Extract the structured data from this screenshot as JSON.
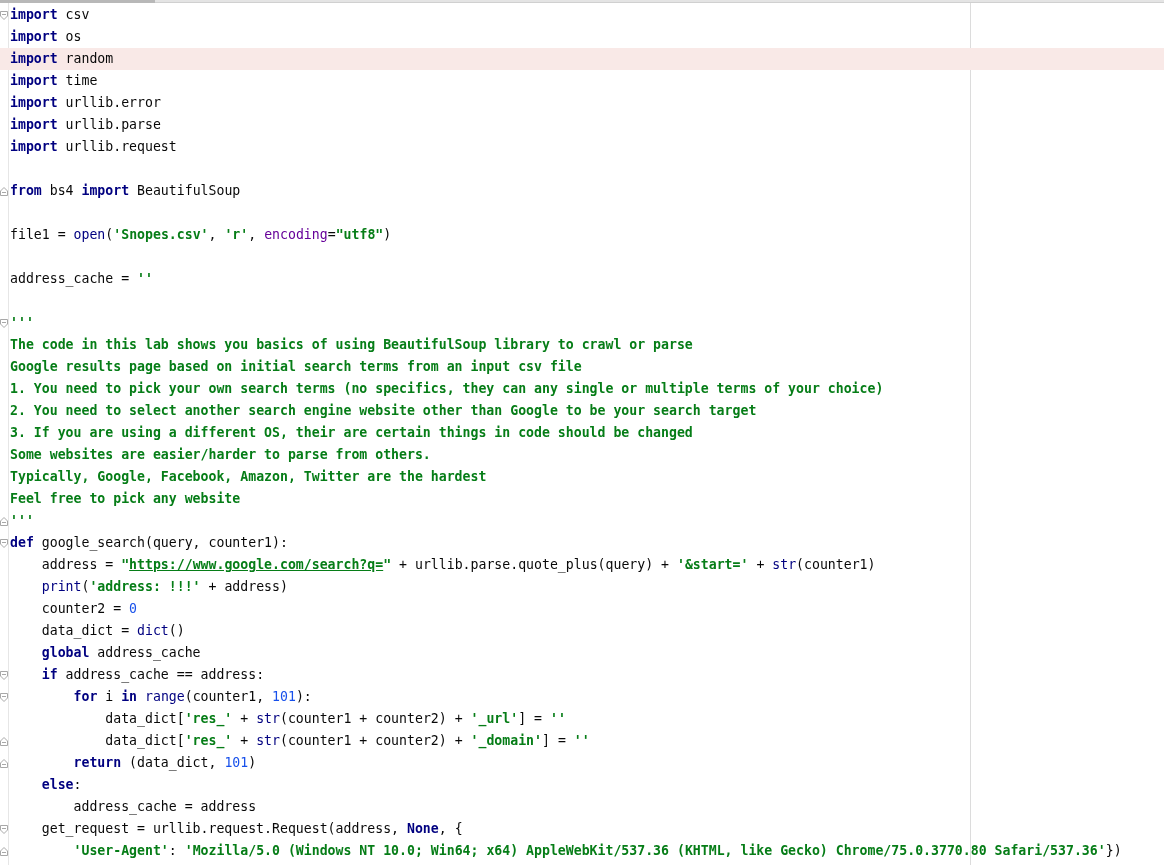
{
  "lines": [
    {
      "highlighted": false,
      "kind": "opener",
      "tokens": [
        {
          "kind": "keyword",
          "text": "import"
        },
        {
          "kind": "text",
          "text": " csv"
        }
      ]
    },
    {
      "highlighted": false,
      "kind": "plain",
      "tokens": [
        {
          "kind": "keyword",
          "text": "import"
        },
        {
          "kind": "text",
          "text": " os"
        }
      ]
    },
    {
      "highlighted": true,
      "kind": "plain",
      "tokens": [
        {
          "kind": "keyword",
          "text": "import"
        },
        {
          "kind": "text",
          "text": " random"
        }
      ]
    },
    {
      "highlighted": false,
      "kind": "plain",
      "tokens": [
        {
          "kind": "keyword",
          "text": "import"
        },
        {
          "kind": "text",
          "text": " time"
        }
      ]
    },
    {
      "highlighted": false,
      "kind": "plain",
      "tokens": [
        {
          "kind": "keyword",
          "text": "import"
        },
        {
          "kind": "text",
          "text": " urllib.error"
        }
      ]
    },
    {
      "highlighted": false,
      "kind": "plain",
      "tokens": [
        {
          "kind": "keyword",
          "text": "import"
        },
        {
          "kind": "text",
          "text": " urllib.parse"
        }
      ]
    },
    {
      "highlighted": false,
      "kind": "plain",
      "tokens": [
        {
          "kind": "keyword",
          "text": "import"
        },
        {
          "kind": "text",
          "text": " urllib.request"
        }
      ]
    },
    {
      "highlighted": false,
      "kind": "plain"
    },
    {
      "highlighted": false,
      "kind": "closer",
      "tokens": [
        {
          "kind": "keyword",
          "text": "from"
        },
        {
          "kind": "text",
          "text": " bs4 "
        },
        {
          "kind": "keyword",
          "text": "import"
        },
        {
          "kind": "text",
          "text": " BeautifulSoup"
        }
      ]
    },
    {
      "highlighted": false,
      "kind": "plain"
    },
    {
      "highlighted": false,
      "kind": "plain",
      "tokens": [
        {
          "kind": "text",
          "text": "file1 = "
        },
        {
          "kind": "builtin",
          "text": "open"
        },
        {
          "kind": "text",
          "text": "("
        },
        {
          "kind": "string",
          "text": "'Snopes.csv'"
        },
        {
          "kind": "text",
          "text": ", "
        },
        {
          "kind": "string",
          "text": "'r'"
        },
        {
          "kind": "text",
          "text": ", "
        },
        {
          "kind": "param",
          "text": "encoding"
        },
        {
          "kind": "text",
          "text": "="
        },
        {
          "kind": "string",
          "text": "\"utf8\""
        },
        {
          "kind": "text",
          "text": ")"
        }
      ]
    },
    {
      "highlighted": false,
      "kind": "plain"
    },
    {
      "highlighted": false,
      "kind": "plain",
      "tokens": [
        {
          "kind": "text",
          "text": "address_cache = "
        },
        {
          "kind": "string",
          "text": "''"
        }
      ]
    },
    {
      "highlighted": false,
      "kind": "plain"
    },
    {
      "highlighted": false,
      "kind": "opener",
      "tokens": [
        {
          "kind": "doc",
          "text": "'''"
        }
      ]
    },
    {
      "highlighted": false,
      "kind": "plain",
      "tokens": [
        {
          "kind": "doc",
          "text": "The code in this lab shows you basics of using BeautifulSoup library to crawl or parse"
        }
      ]
    },
    {
      "highlighted": false,
      "kind": "plain",
      "tokens": [
        {
          "kind": "doc",
          "text": "Google results page based on initial search terms from an input csv file"
        }
      ]
    },
    {
      "highlighted": false,
      "kind": "plain",
      "tokens": [
        {
          "kind": "doc",
          "text": "1. You need to pick your own search terms (no specifics, they can any single or multiple terms of your choice)"
        }
      ]
    },
    {
      "highlighted": false,
      "kind": "plain",
      "tokens": [
        {
          "kind": "doc",
          "text": "2. You need to select another search engine website other than Google to be your search target"
        }
      ]
    },
    {
      "highlighted": false,
      "kind": "plain",
      "tokens": [
        {
          "kind": "doc",
          "text": "3. If you are using a different OS, their are certain things in code should be changed"
        }
      ]
    },
    {
      "highlighted": false,
      "kind": "plain",
      "tokens": [
        {
          "kind": "doc",
          "text": "Some websites are easier/harder to parse from others."
        }
      ]
    },
    {
      "highlighted": false,
      "kind": "plain",
      "tokens": [
        {
          "kind": "doc",
          "text": "Typically, Google, Facebook, Amazon, Twitter are the hardest"
        }
      ]
    },
    {
      "highlighted": false,
      "kind": "plain",
      "tokens": [
        {
          "kind": "doc",
          "text": "Feel free to pick any website"
        }
      ]
    },
    {
      "highlighted": false,
      "kind": "closer",
      "tokens": [
        {
          "kind": "doc",
          "text": "'''"
        }
      ]
    },
    {
      "highlighted": false,
      "kind": "opener",
      "tokens": [
        {
          "kind": "keyword",
          "text": "def"
        },
        {
          "kind": "text",
          "text": " google_search(query, counter1):"
        }
      ],
      "children": [
        {
          "highlighted": false,
          "kind": "plain",
          "tokens": [
            {
              "kind": "text",
              "text": "address = "
            },
            {
              "kind": "string",
              "text": "\""
            },
            {
              "kind": "url",
              "text": "https://www.google.com/search?q="
            },
            {
              "kind": "string",
              "text": "\""
            },
            {
              "kind": "text",
              "text": " + urllib.parse.quote_plus(query) + "
            },
            {
              "kind": "string",
              "text": "'&start='"
            },
            {
              "kind": "text",
              "text": " + "
            },
            {
              "kind": "builtin",
              "text": "str"
            },
            {
              "kind": "text",
              "text": "(counter1)"
            }
          ]
        },
        {
          "highlighted": false,
          "kind": "plain",
          "tokens": [
            {
              "kind": "builtin",
              "text": "print"
            },
            {
              "kind": "text",
              "text": "("
            },
            {
              "kind": "string",
              "text": "'address: !!!'"
            },
            {
              "kind": "text",
              "text": " + address)"
            }
          ]
        },
        {
          "highlighted": false,
          "kind": "plain",
          "tokens": [
            {
              "kind": "text",
              "text": "counter2 = "
            },
            {
              "kind": "number",
              "text": "0"
            }
          ]
        },
        {
          "highlighted": false,
          "kind": "plain",
          "tokens": [
            {
              "kind": "text",
              "text": "data_dict = "
            },
            {
              "kind": "builtin",
              "text": "dict"
            },
            {
              "kind": "text",
              "text": "()"
            }
          ]
        },
        {
          "highlighted": false,
          "kind": "plain",
          "tokens": [
            {
              "kind": "keyword",
              "text": "global"
            },
            {
              "kind": "text",
              "text": " address_cache"
            }
          ]
        },
        {
          "highlighted": false,
          "kind": "opener",
          "tokens": [
            {
              "kind": "keyword",
              "text": "if"
            },
            {
              "kind": "text",
              "text": " address_cache == address:"
            }
          ],
          "children": [
            {
              "highlighted": false,
              "kind": "opener",
              "tokens": [
                {
                  "kind": "keyword",
                  "text": "for"
                },
                {
                  "kind": "text",
                  "text": " i "
                },
                {
                  "kind": "keyword",
                  "text": "in"
                },
                {
                  "kind": "builtin",
                  "text": " range"
                },
                {
                  "kind": "text",
                  "text": "(counter1, "
                },
                {
                  "kind": "number",
                  "text": "101"
                },
                {
                  "kind": "text",
                  "text": "):"
                }
              ],
              "children": [
                {
                  "highlighted": false,
                  "kind": "plain",
                  "tokens": [
                    {
                      "kind": "text",
                      "text": "data_dict["
                    },
                    {
                      "kind": "string",
                      "text": "'res_'"
                    },
                    {
                      "kind": "text",
                      "text": " + "
                    },
                    {
                      "kind": "builtin",
                      "text": "str"
                    },
                    {
                      "kind": "text",
                      "text": "(counter1 + counter2) + "
                    },
                    {
                      "kind": "string",
                      "text": "'_url'"
                    },
                    {
                      "kind": "text",
                      "text": "] = "
                    },
                    {
                      "kind": "string",
                      "text": "''"
                    }
                  ]
                },
                {
                  "highlighted": false,
                  "kind": "closer",
                  "tokens": [
                    {
                      "kind": "text",
                      "text": "data_dict["
                    },
                    {
                      "kind": "string",
                      "text": "'res_'"
                    },
                    {
                      "kind": "text",
                      "text": " + "
                    },
                    {
                      "kind": "builtin",
                      "text": "str"
                    },
                    {
                      "kind": "text",
                      "text": "(counter1 + counter2) + "
                    },
                    {
                      "kind": "string",
                      "text": "'_domain'"
                    },
                    {
                      "kind": "text",
                      "text": "] = "
                    },
                    {
                      "kind": "string",
                      "text": "''"
                    }
                  ]
                }
              ]
            },
            {
              "highlighted": false,
              "kind": "closer",
              "tokens": [
                {
                  "kind": "keyword",
                  "text": "return"
                },
                {
                  "kind": "text",
                  "text": " (data_dict, "
                },
                {
                  "kind": "number",
                  "text": "101"
                },
                {
                  "kind": "text",
                  "text": ")"
                }
              ]
            }
          ]
        },
        {
          "highlighted": false,
          "kind": "plain",
          "tokens": [
            {
              "kind": "keyword",
              "text": "else"
            },
            {
              "kind": "text",
              "text": ":"
            }
          ],
          "children": [
            {
              "highlighted": false,
              "kind": "plain",
              "tokens": [
                {
                  "kind": "text",
                  "text": "address_cache = address"
                }
              ]
            }
          ]
        },
        {
          "highlighted": false,
          "kind": "opener",
          "tokens": [
            {
              "kind": "text",
              "text": "get_request = urllib.request.Request(address, "
            },
            {
              "kind": "keyword",
              "text": "None"
            },
            {
              "kind": "text",
              "text": ", {"
            }
          ],
          "children": [
            {
              "highlighted": false,
              "kind": "closer",
              "tokens": [
                {
                  "kind": "string",
                  "text": "'User-Agent'"
                },
                {
                  "kind": "text",
                  "text": ": "
                },
                {
                  "kind": "string",
                  "text": "'Mozilla/5.0 (Windows NT 10.0; Win64; x64) AppleWebKit/537.36 (KHTML, like Gecko) Chrome/75.0.3770.80 Safari/537.36'"
                },
                {
                  "kind": "text",
                  "text": "})"
                }
              ]
            }
          ]
        }
      ]
    }
  ]
}
